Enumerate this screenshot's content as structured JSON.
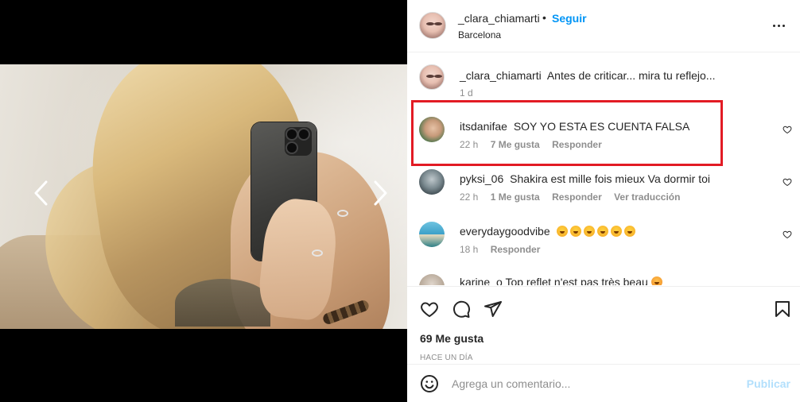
{
  "post": {
    "owner_username": "_clara_chiamarti",
    "separator": "•",
    "follow_label": "Seguir",
    "location": "Barcelona",
    "likes": "69 Me gusta",
    "time_ago": "HACE UN DÍA"
  },
  "comments": [
    {
      "username": "_clara_chiamarti",
      "text": "Antes de criticar... mira tu reflejo...",
      "time": "1 d",
      "likes": "",
      "reply": "",
      "translate": ""
    },
    {
      "username": "itsdanifae",
      "text": "SOY YO ESTA ES CUENTA FALSA",
      "time": "22 h",
      "likes": "7 Me gusta",
      "reply": "Responder",
      "translate": ""
    },
    {
      "username": "pyksi_06",
      "text": "Shakira est mille fois mieux Va dormir toi",
      "time": "22 h",
      "likes": "1 Me gusta",
      "reply": "Responder",
      "translate": "Ver traducción"
    },
    {
      "username": "everydaygoodvibe",
      "text": "",
      "emoji_count": 6,
      "time": "18 h",
      "likes": "",
      "reply": "Responder",
      "translate": ""
    },
    {
      "username": "karine",
      "text": "o Top reflet n'est pas très beau",
      "time": "",
      "likes": "",
      "reply": "",
      "translate": ""
    }
  ],
  "composer": {
    "placeholder": "Agrega un comentario...",
    "publish_label": "Publicar"
  },
  "colors": {
    "link_blue": "#0095f6",
    "publish_disabled": "#b2dffc",
    "highlight_red": "#e21b24",
    "muted_text": "#8e8e8e"
  },
  "icons": [
    "chevron-left-icon",
    "chevron-right-icon",
    "more-options-icon",
    "heart-icon",
    "comment-icon",
    "share-icon",
    "bookmark-icon",
    "emoji-icon"
  ]
}
